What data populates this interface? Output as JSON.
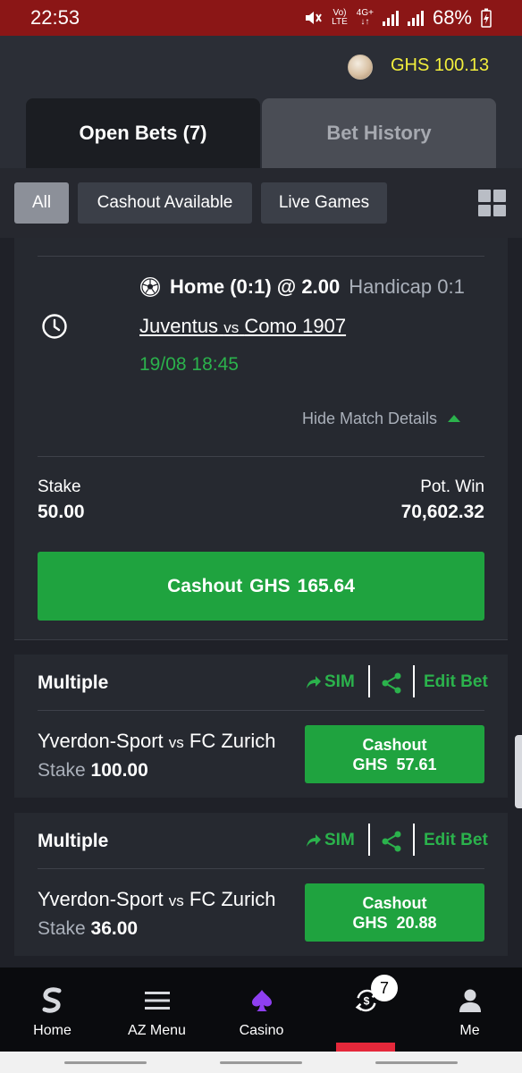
{
  "status_bar": {
    "time": "22:53",
    "network_top": "Vo)",
    "network_bottom": "LTE",
    "data_label": "4G+",
    "battery": "68%"
  },
  "header": {
    "balance": "GHS 100.13"
  },
  "tabs": [
    {
      "label": "Open Bets (7)",
      "active": true
    },
    {
      "label": "Bet History",
      "active": false
    }
  ],
  "filters": [
    {
      "label": "All",
      "active": true
    },
    {
      "label": "Cashout Available"
    },
    {
      "label": "Live Games"
    }
  ],
  "bet_detail": {
    "selection": "Home (0:1) @ 2.00",
    "market": "Handicap 0:1",
    "home": "Juventus",
    "vs": "vs",
    "away": "Como 1907",
    "datetime": "19/08 18:45",
    "toggle_label": "Hide Match Details",
    "stake_label": "Stake",
    "stake_value": "50.00",
    "pot_win_label": "Pot. Win",
    "pot_win_value": "70,602.32",
    "cashout_label": "Cashout",
    "cashout_currency": "GHS",
    "cashout_amount": "165.64"
  },
  "multiples": [
    {
      "title": "Multiple",
      "sim_label": "SIM",
      "edit_label": "Edit Bet",
      "home": "Yverdon-Sport",
      "vs": "vs",
      "away": "FC Zurich",
      "stake_label": "Stake",
      "stake_value": "100.00",
      "cashout_label": "Cashout",
      "cashout_value": "GHS  57.61"
    },
    {
      "title": "Multiple",
      "sim_label": "SIM",
      "edit_label": "Edit Bet",
      "home": "Yverdon-Sport",
      "vs": "vs",
      "away": "FC Zurich",
      "stake_label": "Stake",
      "stake_value": "36.00",
      "cashout_label": "Cashout",
      "cashout_value": "GHS  20.88"
    }
  ],
  "bottom_nav": [
    {
      "label": "Home",
      "icon": "sportybet-logo-icon"
    },
    {
      "label": "AZ Menu",
      "icon": "menu-icon"
    },
    {
      "label": "Casino",
      "icon": "spade-icon"
    },
    {
      "label": "",
      "icon": "cashout-bets-icon",
      "badge": "7",
      "active": true
    },
    {
      "label": "Me",
      "icon": "user-icon"
    }
  ],
  "colors": {
    "accent_green": "#1fa33f",
    "balance_yellow": "#f2ee3c",
    "status_red": "#8b1616",
    "active_red": "#e5283a"
  }
}
